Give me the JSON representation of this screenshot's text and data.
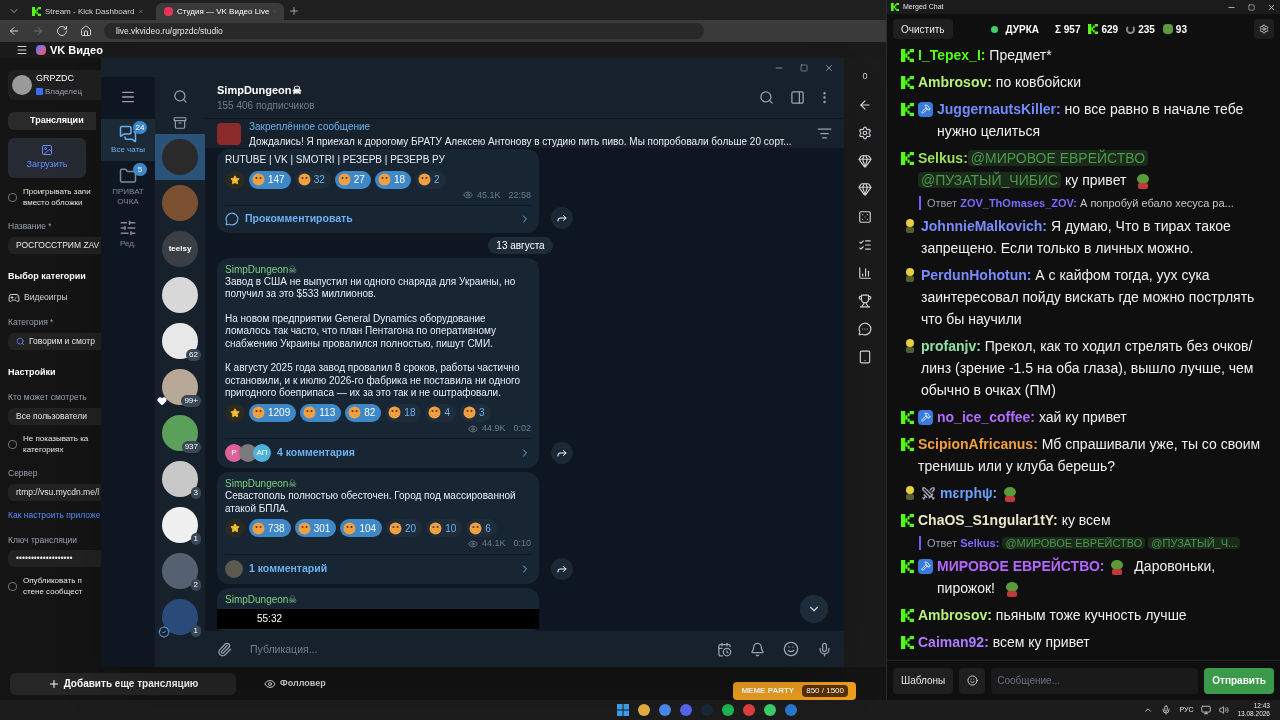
{
  "browser": {
    "tabs": [
      {
        "title": "Stream - Kick Dashboard",
        "selected": false
      },
      {
        "title": "Студия — VK Видео Live",
        "selected": true
      }
    ],
    "url": "live.vkvideo.ru/grpzdc/studio",
    "site": {
      "logo": "VK Видео",
      "counter": "0"
    },
    "studio": {
      "user": "GRPZDC",
      "role": "Владелец",
      "items": [
        {
          "kind": "tab",
          "text": "Трансляции"
        },
        {
          "kind": "upload",
          "text": "Загрузить"
        },
        {
          "kind": "checkbox",
          "lines": [
            "Проигрывать запи",
            "вместо обложки"
          ],
          "checked": false
        },
        {
          "kind": "label",
          "text": "Название *"
        },
        {
          "kind": "field",
          "text": "РОСГОССТРИМ ZAV"
        },
        {
          "kind": "heading",
          "text": "Выбор категории"
        },
        {
          "kind": "category",
          "text": "Видеоигры"
        },
        {
          "kind": "label",
          "text": "Категория *"
        },
        {
          "kind": "search",
          "text": "Говорим и смотр"
        },
        {
          "kind": "heading",
          "text": "Настройки"
        },
        {
          "kind": "label",
          "text": "Кто может смотреть"
        },
        {
          "kind": "field",
          "text": "Все пользователи"
        },
        {
          "kind": "checkbox",
          "lines": [
            "Не показывать ка",
            "категориях"
          ],
          "checked": false
        },
        {
          "kind": "label",
          "text": "Сервер"
        },
        {
          "kind": "field",
          "text": "rtmp://vsu.mycdn.me/l"
        },
        {
          "kind": "link",
          "text": "Как настроить приложе"
        },
        {
          "kind": "label",
          "text": "Ключ трансляции"
        },
        {
          "kind": "field",
          "text": "•••••••••••••••••••"
        },
        {
          "kind": "checkbox",
          "lines": [
            "Опубликовать п",
            "стене сообщест"
          ],
          "checked": false
        }
      ],
      "add_button": "Добавить еще трансляцию",
      "follower": "Фолловер"
    },
    "game_overlay": {
      "title": "MEME PARTY",
      "progress": "850 / 1500"
    }
  },
  "telegram": {
    "folders": [
      {
        "label": "Все чаты",
        "badge": "24",
        "selected": true
      },
      {
        "label": "ПРИВАТ ОЧКА",
        "badge": "5",
        "selected": false
      },
      {
        "label": "Ред.",
        "selected": false
      }
    ],
    "chats": [
      {
        "selected": true,
        "color": "#2a2a2a",
        "heart": false,
        "verified": false
      },
      {
        "selected": false,
        "color": "#7a5030",
        "heart": false,
        "verified": false
      },
      {
        "selected": false,
        "color": "#3a3f45",
        "text": "teelsy",
        "heart": false,
        "verified": false
      },
      {
        "selected": false,
        "color": "#d8d8d8",
        "heart": false,
        "verified": false
      },
      {
        "selected": false,
        "color": "#e8e8e8",
        "badge": "62",
        "heart": false,
        "verified": false
      },
      {
        "selected": false,
        "color": "#b8a898",
        "badge": "99+",
        "heart": true,
        "verified": false
      },
      {
        "selected": false,
        "color": "#5aa05a",
        "badge": "937",
        "heart": false,
        "verified": false
      },
      {
        "selected": false,
        "color": "#c8c8c8",
        "badge": "3",
        "heart": false,
        "verified": false
      },
      {
        "selected": false,
        "color": "#f0f0f0",
        "badge": "1",
        "heart": false,
        "verified": false
      },
      {
        "selected": false,
        "color": "#556070",
        "badge": "2",
        "heart": false,
        "verified": false
      },
      {
        "selected": false,
        "color": "#2a4a7a",
        "badge": "1",
        "heart": false,
        "verified": true
      }
    ],
    "channel": {
      "name": "SimpDungeon☠",
      "subscribers": "155 406 подписчиков"
    },
    "pinned": {
      "title": "Закреплённое сообщение",
      "text": "Дождались!  Я приехал к дорогому БРАТУ Алексею Антонову в студию пить пиво. Мы попробовали больше 20 сорт..."
    },
    "messages": [
      {
        "kind": "post",
        "paragraphs": [
          "RUTUBE | VK | SMOTRI | РЕЗЕРВ | РЕЗЕРВ РУ"
        ],
        "reactions": [
          {
            "kind": "star"
          },
          {
            "kind": "emoji",
            "count": "147",
            "selected": true
          },
          {
            "kind": "emoji",
            "count": "32",
            "selected": false
          },
          {
            "kind": "emoji",
            "count": "27",
            "selected": true
          },
          {
            "kind": "emoji",
            "count": "18",
            "selected": true
          },
          {
            "kind": "emoji",
            "count": "2",
            "selected": false
          }
        ],
        "views": "45.1K",
        "time": "22:58",
        "comments": {
          "text": "Прокомментировать"
        }
      },
      {
        "kind": "date",
        "text": "13 августа"
      },
      {
        "kind": "post",
        "author": "SimpDungeon☠",
        "paragraphs": [
          "Завод в США не выпустил ни одного снаряда для Украины, но получил за это $533 миллионов.",
          "На новом предприятии General Dynamics оборудование ломалось так часто, что план Пентагона по оперативному снабжению Украины провалился полностью, пишут СМИ.",
          "К августу 2025 года завод провалил 8 сроков, работы частично остановили, и к июлю 2026-го фабрика не поставила ни одного пригодного боеприпаса — их за это так и не оштрафовали."
        ],
        "reactions": [
          {
            "kind": "star"
          },
          {
            "kind": "emoji",
            "count": "1209",
            "selected": true
          },
          {
            "kind": "emoji",
            "count": "113",
            "selected": true
          },
          {
            "kind": "emoji",
            "count": "82",
            "selected": true
          },
          {
            "kind": "emoji",
            "count": "18",
            "selected": false
          },
          {
            "kind": "emoji",
            "count": "4",
            "selected": false
          },
          {
            "kind": "emoji",
            "count": "3",
            "selected": false
          }
        ],
        "views": "44.9K",
        "time": "0:02",
        "comments": {
          "avatars": [
            {
              "text": "Р",
              "color": "#e0609a"
            },
            {
              "color": "#7a7a7a"
            },
            {
              "text": "АП",
              "color": "#4fb3d9"
            }
          ],
          "text": "4 комментария"
        }
      },
      {
        "kind": "post",
        "author": "SimpDungeon☠",
        "paragraphs": [
          "Севастополь полностью обесточен. Город под массированной атакой БПЛА."
        ],
        "reactions": [
          {
            "kind": "star"
          },
          {
            "kind": "emoji",
            "count": "738",
            "selected": true
          },
          {
            "kind": "emoji",
            "count": "301",
            "selected": true
          },
          {
            "kind": "emoji",
            "count": "104",
            "selected": true
          },
          {
            "kind": "emoji",
            "count": "20",
            "selected": false
          },
          {
            "kind": "emoji",
            "count": "10",
            "selected": false
          },
          {
            "kind": "emoji",
            "count": "6",
            "selected": false
          }
        ],
        "views": "44.1K",
        "time": "0:10",
        "comments": {
          "avatars": [
            {
              "color": "#5a5a50"
            }
          ],
          "text": "1 комментарий"
        }
      },
      {
        "kind": "post",
        "author": "SimpDungeon☠",
        "video": {
          "duration": "55:32"
        }
      }
    ],
    "composer": {
      "placeholder": "Публикация..."
    }
  },
  "chat": {
    "title": "Merged Chat",
    "clear": "Очистить",
    "channel": {
      "name": "ДУРКА",
      "live": true
    },
    "stats": [
      {
        "kind": "sum",
        "text": "Σ 957"
      },
      {
        "kind": "kick",
        "text": "629"
      },
      {
        "kind": "vk",
        "text": "235"
      },
      {
        "kind": "frog",
        "text": "93"
      }
    ],
    "messages": [
      {
        "kind": "message",
        "icons": [
          {
            "kind": "kick"
          }
        ],
        "user": "I_Tepex_I:",
        "color": "#53fc18",
        "parts": [
          {
            "kind": "text",
            "text": "Предмет*"
          }
        ]
      },
      {
        "kind": "message",
        "icons": [
          {
            "kind": "kick"
          }
        ],
        "user": "Ambrosov:",
        "color": "#b8f07a",
        "parts": [
          {
            "kind": "text",
            "text": "по ковбойски"
          }
        ]
      },
      {
        "kind": "message",
        "icons": [
          {
            "kind": "kick"
          },
          {
            "kind": "mod"
          }
        ],
        "user": "JuggernautsKiller:",
        "color": "#6f8cff",
        "parts": [
          {
            "kind": "text",
            "text": "но все равно в начале тебе нужно целиться"
          }
        ]
      },
      {
        "kind": "message",
        "icons": [
          {
            "kind": "kick"
          }
        ],
        "user": "Selkus:",
        "color": "#9be05a",
        "parts": [
          {
            "kind": "mention",
            "text": "@МИРОВОЕ ЕВРЕЙСТВО"
          },
          {
            "kind": "mention",
            "text": "@ПУЗАТЫЙ_ЧИБИС"
          },
          {
            "kind": "text",
            "text": "ку привет"
          },
          {
            "kind": "emote"
          }
        ]
      },
      {
        "kind": "reply",
        "label": "Ответ",
        "user": "ZOV_ThOmases_ZOV:",
        "parts": [
          {
            "kind": "text",
            "text": "А попробуй ебало хесуса ра..."
          }
        ]
      },
      {
        "kind": "message",
        "icons": [
          {
            "kind": "figure"
          }
        ],
        "user": "JohnnieMalkovich:",
        "color": "#7a8cff",
        "parts": [
          {
            "kind": "text",
            "text": "Я думаю, Что в тирах такое запрещено. Если только в личных можно."
          }
        ]
      },
      {
        "kind": "message",
        "icons": [
          {
            "kind": "figure"
          }
        ],
        "user": "PerdunHohotun:",
        "color": "#7a8cff",
        "parts": [
          {
            "kind": "text",
            "text": "А с кайфом тогда, уух сука заинтересовал пойду вискать  где можно пострлять что бы научили"
          }
        ]
      },
      {
        "kind": "message",
        "icons": [
          {
            "kind": "figure"
          }
        ],
        "user": "profanjv:",
        "color": "#8fe0a8",
        "parts": [
          {
            "kind": "text",
            "text": "Прекол, как то ходил стрелять без очков/линз (зрение -1.5 на оба глаза), вышло лучше, чем обычно в очках (ПМ)"
          }
        ]
      },
      {
        "kind": "message",
        "icons": [
          {
            "kind": "kick"
          },
          {
            "kind": "mod"
          }
        ],
        "user": "no_ice_coffee:",
        "color": "#b36bff",
        "parts": [
          {
            "kind": "text",
            "text": "хай ку привет"
          }
        ]
      },
      {
        "kind": "message",
        "icons": [
          {
            "kind": "kick"
          }
        ],
        "user": "ScipionAfricanus:",
        "color": "#f0a040",
        "parts": [
          {
            "kind": "text",
            "text": "Мб спрашивали уже, ты со своим тренишь или у клуба берешь?"
          }
        ]
      },
      {
        "kind": "message",
        "icons": [
          {
            "kind": "figure"
          },
          {
            "kind": "swords"
          }
        ],
        "user": "mɛrphψ:",
        "color": "#6aa0ff",
        "parts": [
          {
            "kind": "emote"
          }
        ]
      },
      {
        "kind": "message",
        "icons": [
          {
            "kind": "kick"
          }
        ],
        "user": "ChaOS_S1ngular1tY:",
        "color": "#e8e8c8",
        "parts": [
          {
            "kind": "text",
            "text": "ку всем"
          }
        ]
      },
      {
        "kind": "reply",
        "label": "Ответ",
        "user": "Selkus:",
        "parts": [
          {
            "kind": "mention",
            "text": "@МИРОВОЕ ЕВРЕЙСТВО"
          },
          {
            "kind": "mention",
            "text": "@ПУЗАТЫЙ_Ч..."
          }
        ]
      },
      {
        "kind": "message",
        "icons": [
          {
            "kind": "kick"
          },
          {
            "kind": "mod"
          }
        ],
        "user": "МИРОВОЕ ЕВРЕЙСТВО:",
        "color": "#b565ff",
        "parts": [
          {
            "kind": "emote"
          },
          {
            "kind": "text",
            "text": "Даровоньки, пирожок!"
          },
          {
            "kind": "emote"
          }
        ]
      },
      {
        "kind": "message",
        "icons": [
          {
            "kind": "kick"
          }
        ],
        "user": "Ambrosov:",
        "color": "#b8f07a",
        "parts": [
          {
            "kind": "text",
            "text": "пьяным тоже кучность лучше"
          }
        ]
      },
      {
        "kind": "message",
        "icons": [
          {
            "kind": "kick"
          }
        ],
        "user": "Caiman92:",
        "color": "#b07cff",
        "parts": [
          {
            "kind": "text",
            "text": "всем ку привет"
          }
        ]
      }
    ],
    "templates": "Шаблоны",
    "placeholder": "Сообщение...",
    "send": "Отправить"
  },
  "taskbar": {
    "language": "РУС",
    "time": "12:43",
    "date": "13.08.2026"
  }
}
